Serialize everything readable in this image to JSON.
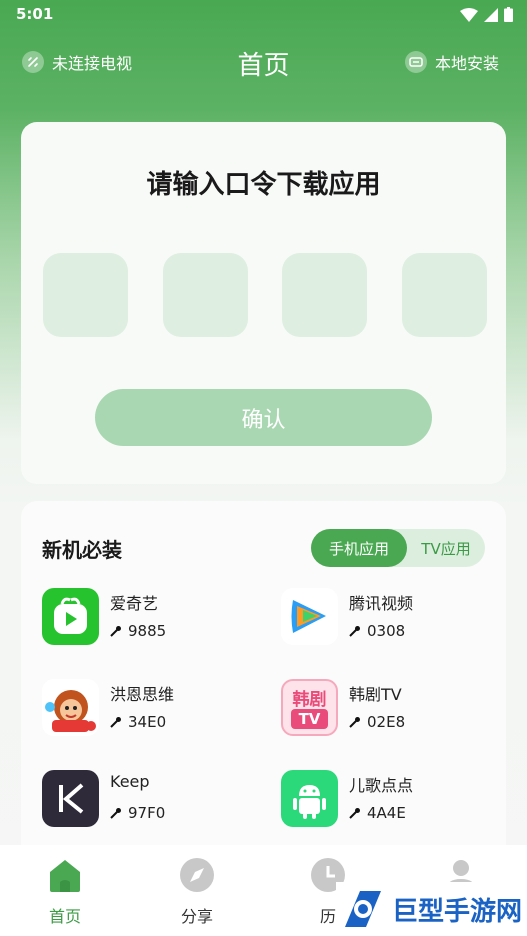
{
  "status": {
    "time": "5:01"
  },
  "topbar": {
    "left_label": "未连接电视",
    "title": "首页",
    "right_label": "本地安装"
  },
  "code_card": {
    "heading": "请输入口令下载应用",
    "confirm_label": "确认"
  },
  "recommend": {
    "title": "新机必装",
    "tabs": [
      {
        "label": "手机应用",
        "active": true
      },
      {
        "label": "TV应用",
        "active": false
      }
    ],
    "apps": [
      {
        "name": "爱奇艺",
        "code": "9885",
        "icon": "iqiyi-icon"
      },
      {
        "name": "腾讯视频",
        "code": "0308",
        "icon": "tencent-video-icon"
      },
      {
        "name": "洪恩思维",
        "code": "34E0",
        "icon": "hongen-icon"
      },
      {
        "name": "韩剧TV",
        "code": "02E8",
        "icon": "hanju-tv-icon",
        "icon_text_top": "韩剧",
        "icon_text_bottom": "TV"
      },
      {
        "name": "Keep",
        "code": "97F0",
        "icon": "keep-icon"
      },
      {
        "name": "儿歌点点",
        "code": "4A4E",
        "icon": "android-icon"
      }
    ]
  },
  "nav": {
    "items": [
      {
        "label": "首页",
        "icon": "home-icon",
        "active": true
      },
      {
        "label": "分享",
        "icon": "compass-icon",
        "active": false
      },
      {
        "label": "历",
        "icon": "clock-icon",
        "active": false
      },
      {
        "label": "",
        "icon": "profile-icon",
        "active": false
      }
    ]
  },
  "watermark": {
    "text": "巨型手游网"
  },
  "colors": {
    "accent": "#4aa852",
    "confirm_disabled": "#a9d7b1",
    "code_box": "#deeee0"
  }
}
